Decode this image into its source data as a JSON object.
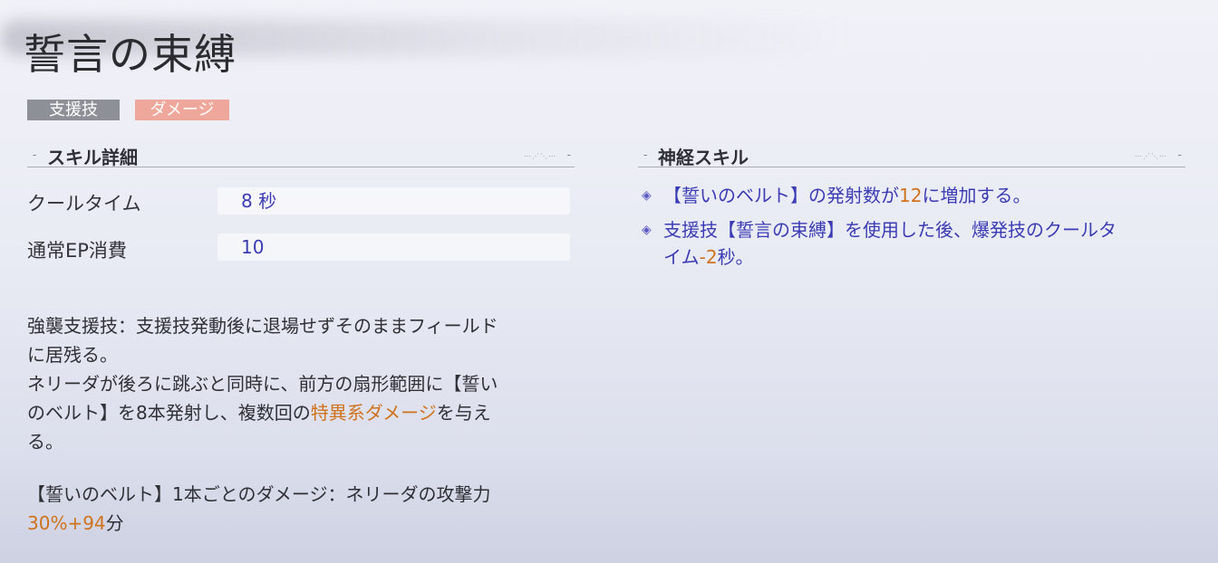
{
  "skill": {
    "title": "誓言の束縛",
    "tags": [
      "支援技",
      "ダメージ"
    ]
  },
  "details": {
    "header": "スキル詳細",
    "cooldown_label": "クールタイム",
    "cooldown_value": "8 秒",
    "ep_label": "通常EP消費",
    "ep_value": "10",
    "desc_line1": "強襲支援技：支援技発動後に退場せずそのままフィールド",
    "desc_line2": "に居残る。",
    "desc_line3": "ネリーダが後ろに跳ぶと同時に、前方の扇形範囲に【誓い",
    "desc_line4a": "のベルト】を8本発射し、複数回の",
    "desc_line4b": "特異系ダメージ",
    "desc_line4c": "を与え",
    "desc_line5": "る。",
    "dmg_line1": "【誓いのベルト】1本ごとのダメージ：ネリーダの攻撃力",
    "dmg_line2a": "30%+94",
    "dmg_line2b": "分"
  },
  "neural": {
    "header": "神経スキル",
    "b1a": "【誓いのベルト】の発射数が",
    "b1b": "12",
    "b1c": "に増加する。",
    "b2a": "支援技【誓言の束縛】を使用した後、爆発技のクールタ",
    "b2b": "イム",
    "b2c": "-2",
    "b2d": "秒。"
  },
  "colors": {
    "accent_blue": "#3b3bb4",
    "accent_orange": "#d0721c",
    "tag_gray": "#8e9097",
    "tag_red": "#f0a79b"
  }
}
